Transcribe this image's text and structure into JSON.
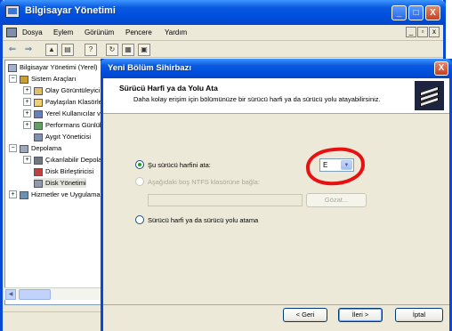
{
  "main_window": {
    "title": "Bilgisayar Yönetimi",
    "controls": {
      "minimize": "_",
      "maximize": "□",
      "close": "X"
    },
    "menu": [
      "Dosya",
      "Eylem",
      "Görünüm",
      "Pencere",
      "Yardım"
    ],
    "mdi_controls": [
      "_",
      "▫",
      "x"
    ],
    "toolbar_icons": [
      "back-arrow-icon",
      "forward-arrow-icon",
      "up-folder-icon",
      "show-tree-icon",
      "help-icon",
      "refresh-icon",
      "properties-icon",
      "export-icon"
    ]
  },
  "tree": {
    "items": [
      {
        "label": "Bilgisayar Yönetimi (Yerel)",
        "level": 0,
        "expander": ""
      },
      {
        "label": "Sistem Araçları",
        "level": 1,
        "expander": "−"
      },
      {
        "label": "Olay Görüntüleyici",
        "level": 2,
        "expander": "+"
      },
      {
        "label": "Paylaşılan Klasörler",
        "level": 2,
        "expander": "+"
      },
      {
        "label": "Yerel Kullanıcılar ve",
        "level": 2,
        "expander": "+"
      },
      {
        "label": "Performans Günlükleri",
        "level": 2,
        "expander": "+"
      },
      {
        "label": "Aygıt Yöneticisi",
        "level": 2,
        "expander": ""
      },
      {
        "label": "Depolama",
        "level": 1,
        "expander": "−"
      },
      {
        "label": "Çıkarılabilir Depolama",
        "level": 2,
        "expander": "+"
      },
      {
        "label": "Disk Birleştiricisi",
        "level": 2,
        "expander": ""
      },
      {
        "label": "Disk Yönetimi",
        "level": 2,
        "expander": ""
      },
      {
        "label": "Hizmetler ve Uygulamalar",
        "level": 1,
        "expander": "+"
      }
    ]
  },
  "wizard": {
    "title": "Yeni Bölüm Sihirbazı",
    "close": "X",
    "header_title": "Sürücü Harfi ya da Yolu Ata",
    "header_subtitle": "Daha kolay erişim için bölümünüze bir sürücü harfi ya da sürücü yolu atayabilirsiniz.",
    "options": [
      {
        "label": "Şu sürücü harfini ata:",
        "selected": true,
        "enabled": true
      },
      {
        "label": "Aşağıdaki boş NTFS klasörüne bağla:",
        "selected": false,
        "enabled": false
      },
      {
        "label": "Sürücü harfi ya da sürücü yolu atama",
        "selected": false,
        "enabled": true
      }
    ],
    "drive_letter": "E",
    "path_value": "",
    "browse_label": "Gözat...",
    "buttons": {
      "back": "< Geri",
      "next": "İleri >",
      "cancel": "İptal"
    }
  },
  "colors": {
    "titlebar": "#0a5ae0",
    "annotation_circle": "#e81010",
    "dialog_bg": "#ece9d8"
  }
}
